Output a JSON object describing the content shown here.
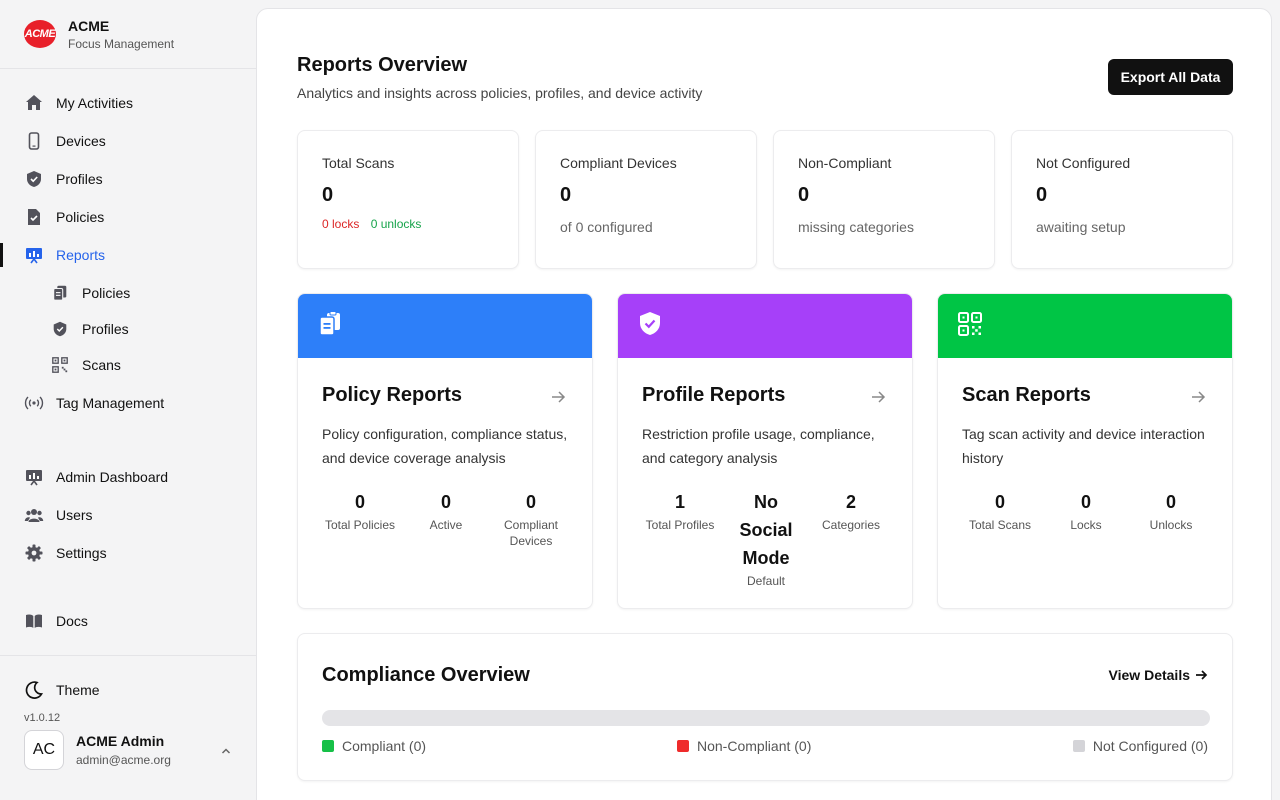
{
  "brand": {
    "logo_text": "ACME",
    "name": "ACME",
    "subtitle": "Focus Management",
    "logo_color": "#e8202a"
  },
  "sidebar": {
    "items": [
      {
        "label": "My Activities",
        "icon": "home-icon"
      },
      {
        "label": "Devices",
        "icon": "phone-icon"
      },
      {
        "label": "Profiles",
        "icon": "shield-icon"
      },
      {
        "label": "Policies",
        "icon": "document-check-icon"
      },
      {
        "label": "Reports",
        "icon": "presentation-chart-icon",
        "active": true
      },
      {
        "label": "Policies",
        "icon": "documents-icon",
        "sub": true
      },
      {
        "label": "Profiles",
        "icon": "shield-icon",
        "sub": true
      },
      {
        "label": "Scans",
        "icon": "qr-code-icon",
        "sub": true
      },
      {
        "label": "Tag Management",
        "icon": "signal-icon"
      },
      {
        "label": "Admin Dashboard",
        "icon": "presentation-chart-icon"
      },
      {
        "label": "Users",
        "icon": "users-icon"
      },
      {
        "label": "Settings",
        "icon": "gear-icon"
      },
      {
        "label": "Docs",
        "icon": "book-icon"
      }
    ],
    "theme_label": "Theme",
    "version": "v1.0.12",
    "user": {
      "initials": "AC",
      "name": "ACME Admin",
      "email": "admin@acme.org"
    }
  },
  "header": {
    "title": "Reports Overview",
    "subtitle": "Analytics and insights across policies, profiles, and device activity",
    "export_label": "Export All Data"
  },
  "stats": [
    {
      "label": "Total Scans",
      "value": "0",
      "locks": "0 locks",
      "unlocks": "0 unlocks"
    },
    {
      "label": "Compliant Devices",
      "value": "0",
      "desc": "of 0 configured"
    },
    {
      "label": "Non-Compliant",
      "value": "0",
      "desc": "missing categories"
    },
    {
      "label": "Not Configured",
      "value": "0",
      "desc": "awaiting setup"
    }
  ],
  "report_cards": [
    {
      "title": "Policy Reports",
      "icon": "documents-icon",
      "color": "#2d7ff9",
      "desc": "Policy configuration, compliance status, and device coverage analysis",
      "metrics": [
        {
          "value": "0",
          "label": "Total Policies"
        },
        {
          "value": "0",
          "label": "Active"
        },
        {
          "value": "0",
          "label": "Compliant Devices"
        }
      ]
    },
    {
      "title": "Profile Reports",
      "icon": "shield-check-icon",
      "color": "#a640f9",
      "desc": "Restriction profile usage, compliance, and category analysis",
      "metrics": [
        {
          "value": "1",
          "label": "Total Profiles"
        },
        {
          "value": "No Social Mode",
          "label": "Default"
        },
        {
          "value": "2",
          "label": "Categories"
        }
      ]
    },
    {
      "title": "Scan Reports",
      "icon": "qr-code-icon",
      "color": "#00c545",
      "desc": "Tag scan activity and device interaction history",
      "metrics": [
        {
          "value": "0",
          "label": "Total Scans"
        },
        {
          "value": "0",
          "label": "Locks"
        },
        {
          "value": "0",
          "label": "Unlocks"
        }
      ]
    }
  ],
  "compliance": {
    "title": "Compliance Overview",
    "link_label": "View Details",
    "compliant_fraction": 0,
    "non_compliant_fraction": 0,
    "legend": [
      {
        "label": "Compliant (0)",
        "color": "#16c047"
      },
      {
        "label": "Non-Compliant (0)",
        "color": "#ef2b2b"
      },
      {
        "label": "Not Configured (0)",
        "color": "#d4d4d8"
      }
    ]
  }
}
